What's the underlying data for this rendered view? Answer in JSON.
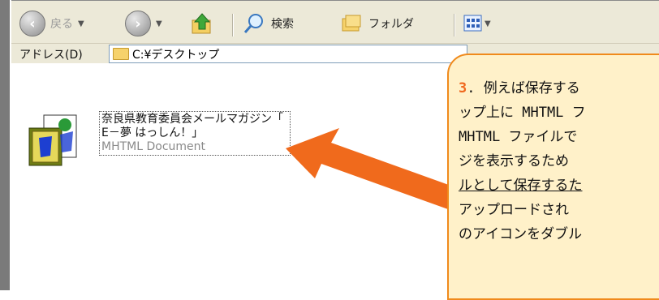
{
  "toolbar": {
    "back_label": "戻る",
    "search_label": "検索",
    "folders_label": "フォルダ"
  },
  "address": {
    "label": "アドレス(D)",
    "path": "C:¥デスクトップ"
  },
  "file": {
    "name_line1": "奈良県教育委員会メールマガジン「",
    "name_line2": "E－夢 はっしん！」",
    "type": "MHTML Document"
  },
  "note": {
    "number": "3",
    "line1_rest": ". 例えば保存する",
    "line2": "ップ上に MHTML フ",
    "line3": " MHTML ファイルで",
    "line4": "ジを表示するため",
    "line5": "ルとして保存するた",
    "line6": " アップロードされ",
    "line7": "のアイコンをダブル"
  },
  "colors": {
    "arrow": "#f06a1c",
    "note_bg": "#fff1c9",
    "note_border": "#f08a1c"
  }
}
